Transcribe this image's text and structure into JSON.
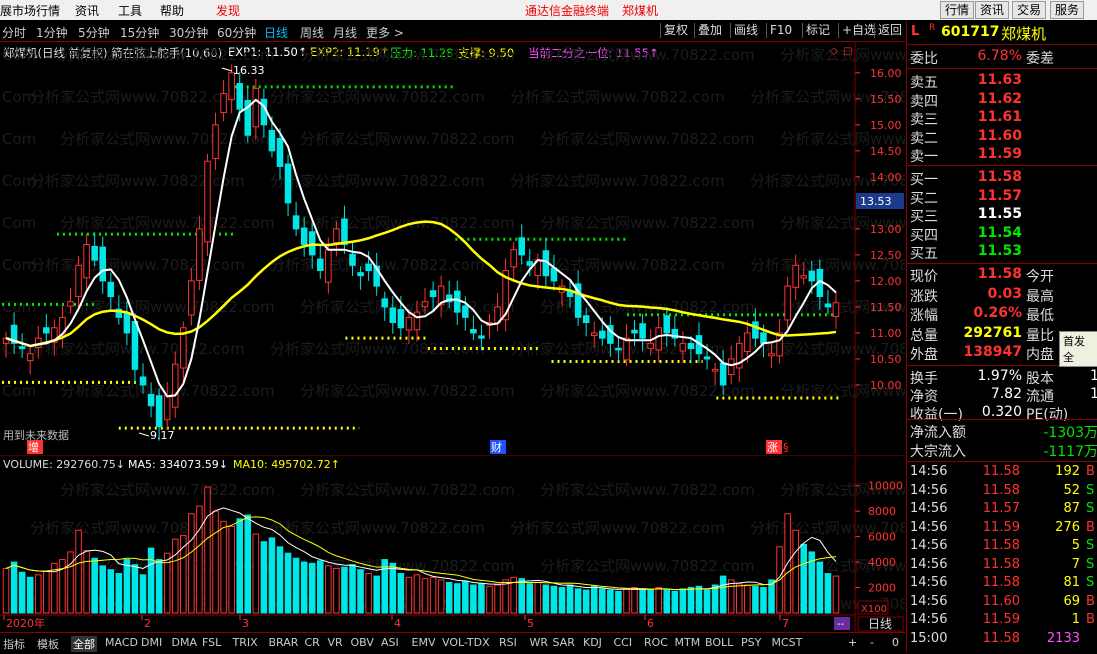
{
  "menu": {
    "left_title": "展市场行情",
    "items": [
      "资讯",
      "工具",
      "帮助"
    ],
    "alert": "发现",
    "center_title": "通达信金融终端",
    "center_stock": "郑煤机",
    "right_buttons": [
      "行情",
      "资讯",
      "交易",
      "服务"
    ]
  },
  "periods": [
    "分时",
    "1分钟",
    "5分钟",
    "15分钟",
    "30分钟",
    "60分钟",
    "日线",
    "周线",
    "月线",
    "更多 >"
  ],
  "active_period": "日线",
  "toolbar": [
    "复权",
    "叠加",
    "画线",
    "F10",
    "标记",
    "+自选",
    "返回"
  ],
  "indicator_line": {
    "name": "郑煤机(日线 前复权) 箭在弦上舵手(10,60)",
    "exp1": "EXP1: 11.50↑",
    "exp2": "EXP2: 11.19↑",
    "pressure": "压力: 11.28",
    "support": "支撑: 9.50",
    "half": "当前二分之一位: 11.55↑"
  },
  "chart": {
    "high_label": "16.33",
    "low_label": "9.17",
    "current_price_tag": "13.53",
    "future_data_note": "用到未来数据",
    "markers": [
      "增",
      "财",
      "涨"
    ],
    "price_ticks": [
      "16.00",
      "15.50",
      "15.00",
      "14.50",
      "14.00",
      "13.00",
      "12.50",
      "12.00",
      "11.50",
      "11.00",
      "10.50",
      "10.00"
    ],
    "watermark": "分析家公式网www.70822.com",
    "watermark_tail": "Com"
  },
  "volume": {
    "label": "VOLUME: 292760.75↓",
    "ma5": "MA5: 334073.59↓",
    "ma10": "MA10: 495702.72↑",
    "ticks": [
      "10000",
      "8000",
      "6000",
      "4000",
      "2000"
    ],
    "unit": "X100",
    "months": [
      "2020年",
      "2",
      "3",
      "4",
      "5",
      "6",
      "7"
    ]
  },
  "bottom": {
    "tabs": [
      "指标",
      "模板",
      "全部",
      "MACD",
      "DMI",
      "DMA",
      "FSL",
      "TRIX",
      "BRAR",
      "CR",
      "VR",
      "OBV",
      "ASI",
      "EMV",
      "VOL-TDX",
      "RSI",
      "WR",
      "SAR",
      "KDJ",
      "CCI",
      "ROC",
      "MTM",
      "BOLL",
      "PSY",
      "MCST"
    ],
    "period_btn": "日线",
    "plus": "+",
    "minus": "-",
    "zero": "0"
  },
  "quote": {
    "badge_l": "L",
    "badge_r": "R",
    "code": "601717",
    "name": "郑煤机",
    "weibi_label": "委比",
    "weibi_value": "6.78%",
    "weicha_label": "委差",
    "asks": [
      {
        "label": "卖五",
        "price": "11.63"
      },
      {
        "label": "卖四",
        "price": "11.62"
      },
      {
        "label": "卖三",
        "price": "11.61"
      },
      {
        "label": "卖二",
        "price": "11.60"
      },
      {
        "label": "卖一",
        "price": "11.59"
      }
    ],
    "bids": [
      {
        "label": "买一",
        "price": "11.58",
        "color": "#ff3232"
      },
      {
        "label": "买二",
        "price": "11.57",
        "color": "#ff3232"
      },
      {
        "label": "买三",
        "price": "11.55",
        "color": "#ffffff"
      },
      {
        "label": "买四",
        "price": "11.54",
        "color": "#00e600"
      },
      {
        "label": "买五",
        "price": "11.53",
        "color": "#00e600"
      }
    ],
    "stats": [
      {
        "l1": "现价",
        "v1": "11.58",
        "c1": "#ff3232",
        "l2": "今开"
      },
      {
        "l1": "涨跌",
        "v1": "0.03",
        "c1": "#ff3232",
        "l2": "最高"
      },
      {
        "l1": "涨幅",
        "v1": "0.26%",
        "c1": "#ff3232",
        "l2": "最低"
      },
      {
        "l1": "总量",
        "v1": "292761",
        "c1": "#ffff00",
        "l2": "量比"
      },
      {
        "l1": "外盘",
        "v1": "138947",
        "c1": "#ff3232",
        "l2": "内盘"
      }
    ],
    "stats2": [
      {
        "l1": "换手",
        "v1": "1.97%",
        "c1": "#ffffff",
        "l2": "股本",
        "v2": "1"
      },
      {
        "l1": "净资",
        "v1": "7.82",
        "c1": "#ffffff",
        "l2": "流通",
        "v2": "1"
      },
      {
        "l1": "收益(一)",
        "v1": "0.320",
        "c1": "#ffffff",
        "l2": "PE(动)",
        "v2": ""
      }
    ],
    "tooltip": "首发 全",
    "netflow_label": "净流入额",
    "netflow_value": "-1303万",
    "block_label": "大宗流入",
    "block_value": "-1117万",
    "ticks": [
      {
        "t": "14:56",
        "p": "11.58",
        "pc": "#ff3232",
        "v": "192",
        "vc": "#ffff00",
        "d": "B",
        "dc": "#ff3232"
      },
      {
        "t": "14:56",
        "p": "11.58",
        "pc": "#ff3232",
        "v": "52",
        "vc": "#ffff00",
        "d": "S",
        "dc": "#00e600"
      },
      {
        "t": "14:56",
        "p": "11.57",
        "pc": "#ff3232",
        "v": "87",
        "vc": "#ffff00",
        "d": "S",
        "dc": "#00e600"
      },
      {
        "t": "14:56",
        "p": "11.59",
        "pc": "#ff3232",
        "v": "276",
        "vc": "#ffff00",
        "d": "B",
        "dc": "#ff3232"
      },
      {
        "t": "14:56",
        "p": "11.58",
        "pc": "#ff3232",
        "v": "5",
        "vc": "#ffff00",
        "d": "S",
        "dc": "#00e600"
      },
      {
        "t": "14:56",
        "p": "11.58",
        "pc": "#ff3232",
        "v": "7",
        "vc": "#ffff00",
        "d": "S",
        "dc": "#00e600"
      },
      {
        "t": "14:56",
        "p": "11.58",
        "pc": "#ff3232",
        "v": "81",
        "vc": "#ffff00",
        "d": "S",
        "dc": "#00e600"
      },
      {
        "t": "14:56",
        "p": "11.60",
        "pc": "#ff3232",
        "v": "69",
        "vc": "#ffff00",
        "d": "B",
        "dc": "#ff3232"
      },
      {
        "t": "14:56",
        "p": "11.59",
        "pc": "#ff3232",
        "v": "1",
        "vc": "#ffff00",
        "d": "B",
        "dc": "#ff3232"
      },
      {
        "t": "15:00",
        "p": "11.58",
        "pc": "#ff3232",
        "v": "2133",
        "vc": "#ff50ff",
        "d": "",
        "dc": "#ff3232"
      }
    ]
  },
  "chart_data": {
    "type": "candlestick",
    "price_axis_range": [
      9.0,
      16.4
    ],
    "high": 16.33,
    "low": 9.17,
    "closes_approx": [
      10.9,
      10.8,
      10.7,
      10.6,
      10.9,
      11.0,
      11.1,
      11.3,
      11.6,
      12.3,
      12.7,
      12.4,
      12.0,
      11.7,
      11.3,
      11.0,
      10.3,
      10.0,
      9.6,
      9.2,
      9.8,
      10.4,
      11.1,
      12.0,
      13.0,
      14.3,
      15.0,
      15.6,
      16.0,
      15.3,
      14.8,
      15.7,
      15.0,
      14.5,
      14.2,
      13.5,
      13.0,
      12.7,
      12.5,
      12.2,
      12.6,
      13.0,
      12.7,
      12.3,
      12.1,
      12.2,
      11.9,
      11.5,
      11.2,
      11.1,
      11.3,
      11.4,
      11.6,
      11.7,
      11.9,
      11.6,
      11.4,
      11.3,
      11.0,
      10.9,
      11.2,
      11.5,
      12.2,
      12.6,
      12.5,
      12.3,
      12.4,
      12.1,
      12.0,
      11.9,
      11.7,
      11.3,
      11.2,
      11.0,
      10.9,
      10.8,
      10.7,
      10.9,
      11.0,
      10.9,
      10.8,
      11.1,
      11.0,
      10.9,
      10.8,
      10.7,
      10.6,
      10.5,
      10.3,
      10.0,
      10.5,
      10.8,
      11.0,
      10.9,
      10.8,
      10.6,
      11.0,
      11.9,
      12.3,
      12.1,
      12.0,
      11.7,
      11.5,
      11.58
    ],
    "support_levels": [
      9.5,
      10.0,
      10.5,
      11.0,
      11.28
    ],
    "volume_axis_range": [
      0,
      11000
    ],
    "volume_approx": [
      3500,
      4000,
      3200,
      2800,
      3000,
      3300,
      3900,
      4200,
      4800,
      6500,
      4900,
      4300,
      3700,
      3400,
      3100,
      4200,
      3800,
      3000,
      5100,
      4200,
      4700,
      5800,
      6100,
      7800,
      8400,
      9900,
      8000,
      7200,
      6800,
      7400,
      7700,
      6200,
      5600,
      5900,
      5200,
      4700,
      4300,
      4000,
      3900,
      4100,
      3700,
      3500,
      3600,
      3800,
      3400,
      3100,
      2900,
      4200,
      3900,
      3100,
      2800,
      3000,
      2700,
      2800,
      2600,
      2400,
      2300,
      2500,
      2200,
      2300,
      2100,
      2200,
      2600,
      2800,
      2700,
      2300,
      2400,
      2200,
      2100,
      2000,
      2200,
      1900,
      1800,
      2100,
      1900,
      1800,
      1700,
      1900,
      2000,
      1900,
      1800,
      2000,
      1800,
      1700,
      1900,
      2000,
      2100,
      1800,
      2200,
      2900,
      2600,
      2300,
      2200,
      2100,
      2000,
      2600,
      5200,
      7800,
      6500,
      5400,
      4800,
      4000,
      3100,
      2900
    ],
    "ma_white": "short moving average (white)",
    "ma_yellow": "long moving average (yellow)"
  }
}
